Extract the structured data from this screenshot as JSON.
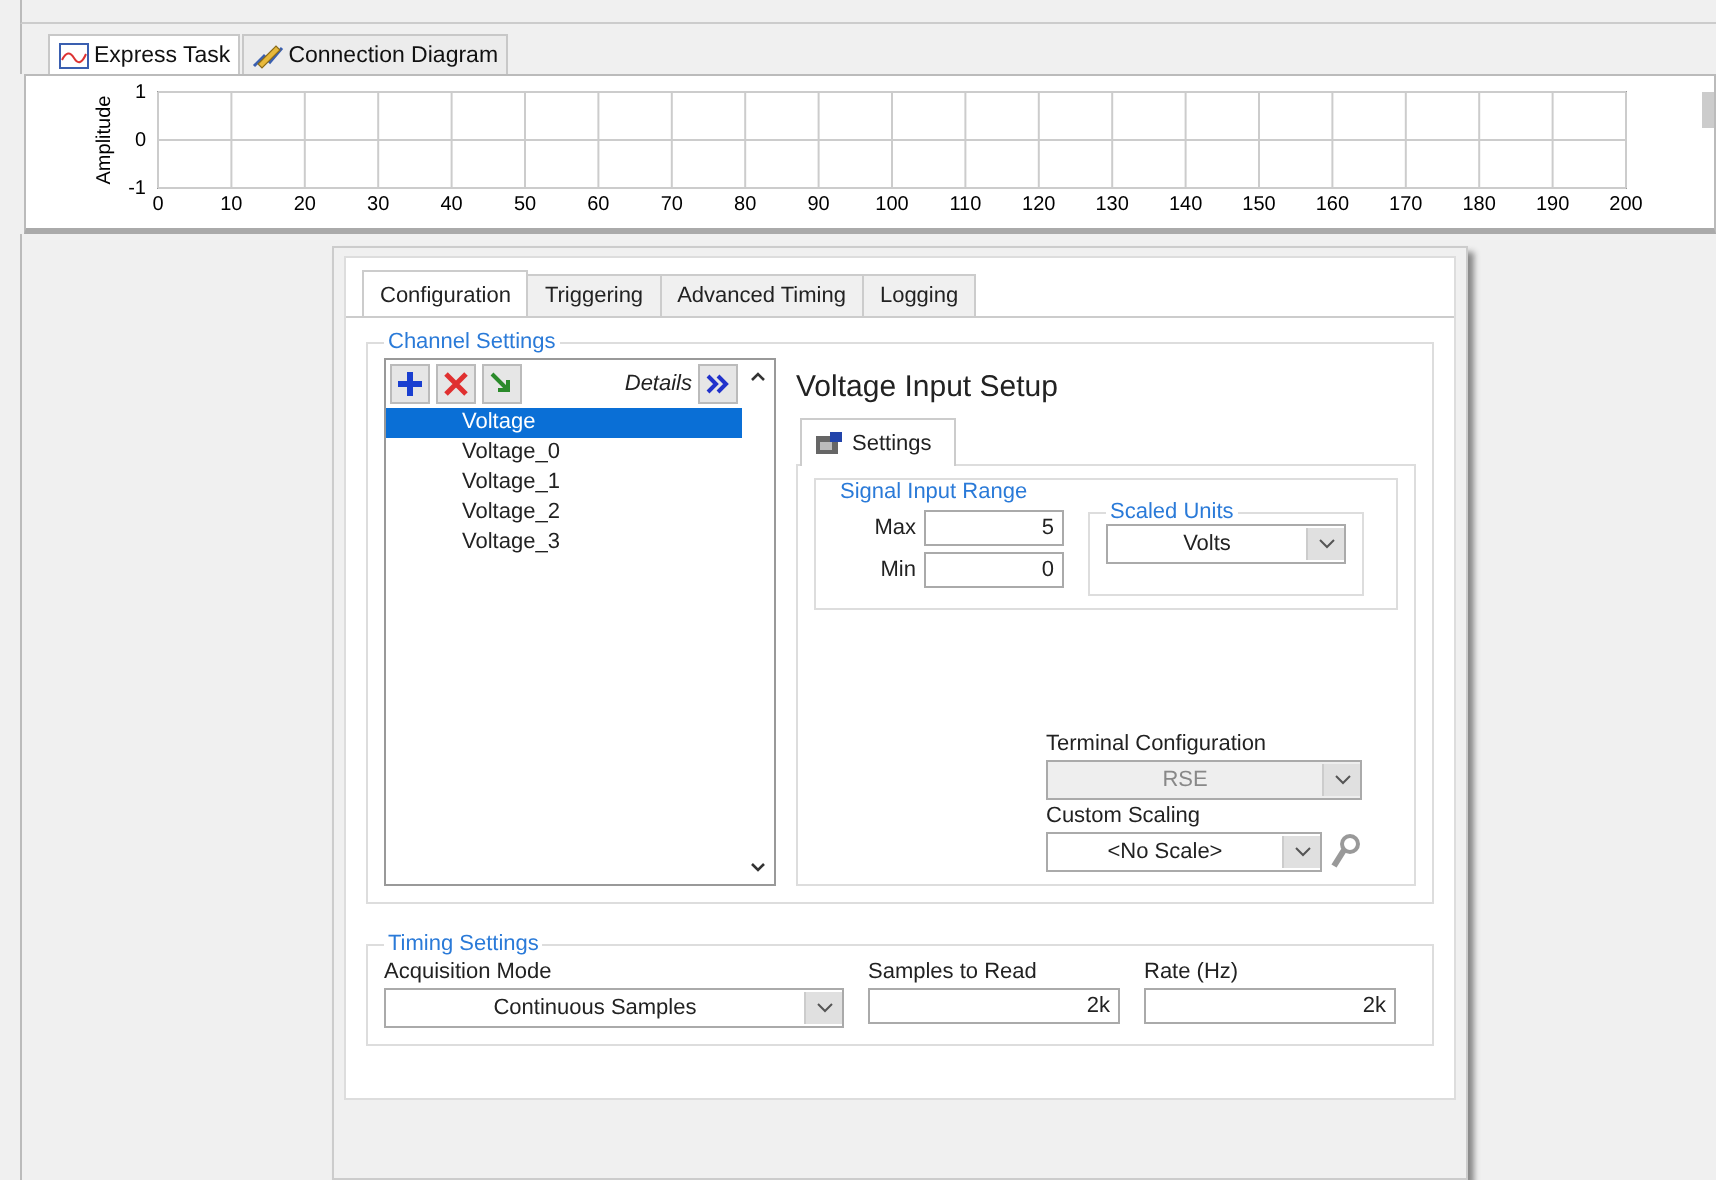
{
  "view_tabs": [
    {
      "label": "Express Task",
      "selected": true
    },
    {
      "label": "Connection Diagram",
      "selected": false
    }
  ],
  "graph": {
    "chart_data": {
      "type": "line",
      "grid": true,
      "ylabel": "Amplitude",
      "xlim": [
        0,
        200
      ],
      "ylim": [
        -1,
        1
      ],
      "xticks": [
        0,
        10,
        20,
        30,
        40,
        50,
        60,
        70,
        80,
        90,
        100,
        110,
        120,
        130,
        140,
        150,
        160,
        170,
        180,
        190,
        200
      ],
      "yticks": [
        {
          "value": -1,
          "label": "-1"
        },
        0,
        1
      ]
    }
  },
  "dialog_tabs": [
    {
      "label": "Configuration",
      "selected": true
    },
    {
      "label": "Triggering",
      "selected": false
    },
    {
      "label": "Advanced Timing",
      "selected": false
    },
    {
      "label": "Logging",
      "selected": false
    }
  ],
  "channel_settings": {
    "title": "Channel Settings",
    "details_label": "Details",
    "channels": [
      {
        "name": "Voltage",
        "selected": true
      },
      {
        "name": "Voltage_0",
        "selected": false
      },
      {
        "name": "Voltage_1",
        "selected": false
      },
      {
        "name": "Voltage_2",
        "selected": false
      },
      {
        "name": "Voltage_3",
        "selected": false
      }
    ]
  },
  "setup": {
    "title": "Voltage Input Setup",
    "tab": "Settings",
    "range_title": "Signal Input Range",
    "max_label": "Max",
    "max": "5",
    "min_label": "Min",
    "min": "0",
    "units_title": "Scaled Units",
    "units": "Volts",
    "terminal_label": "Terminal Configuration",
    "terminal": "RSE",
    "terminal_disabled": true,
    "scaling_label": "Custom Scaling",
    "scaling": "<No Scale>"
  },
  "timing": {
    "title": "Timing Settings",
    "mode_label": "Acquisition Mode",
    "mode": "Continuous Samples",
    "samples_label": "Samples to Read",
    "samples": "2k",
    "rate_label": "Rate (Hz)",
    "rate": "2k"
  }
}
